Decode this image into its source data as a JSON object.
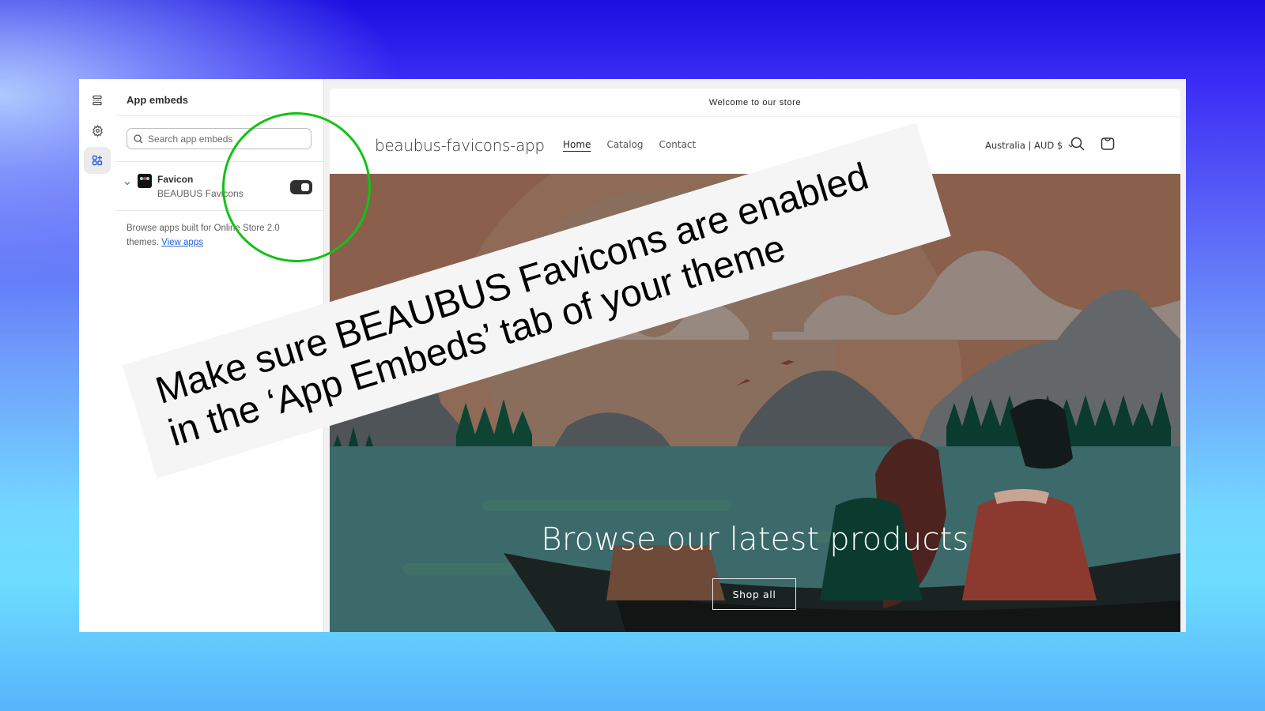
{
  "background": {
    "gradient_top": "#1b0fe0",
    "gradient_bottom": "#56b4fb"
  },
  "rail": {
    "items": [
      {
        "name": "sections",
        "icon": "sections-icon"
      },
      {
        "name": "theme-settings",
        "icon": "gear-icon"
      },
      {
        "name": "app-embeds",
        "icon": "app-embeds-icon",
        "active": true
      }
    ]
  },
  "panel": {
    "title": "App embeds",
    "search": {
      "placeholder": "Search app embeds",
      "value": ""
    },
    "embeds": [
      {
        "name": "Favicon",
        "app": "BEAUBUS Favicons",
        "enabled": true
      }
    ],
    "browse_text": "Browse apps built for Online Store 2.0 themes.",
    "browse_link": "View apps"
  },
  "store": {
    "announcement": "Welcome to our store",
    "logo": "beaubus-favicons-app",
    "nav": [
      {
        "label": "Home",
        "current": true
      },
      {
        "label": "Catalog",
        "current": false
      },
      {
        "label": "Contact",
        "current": false
      }
    ],
    "locale": "Australia | AUD $",
    "hero": {
      "title": "Browse our latest products",
      "button": "Shop all"
    }
  },
  "annotation": {
    "line1": "Make sure BEAUBUS Favicons are enabled",
    "line2": "in the ‘App Embeds’ tab of your theme",
    "highlight_color": "#13c213"
  }
}
